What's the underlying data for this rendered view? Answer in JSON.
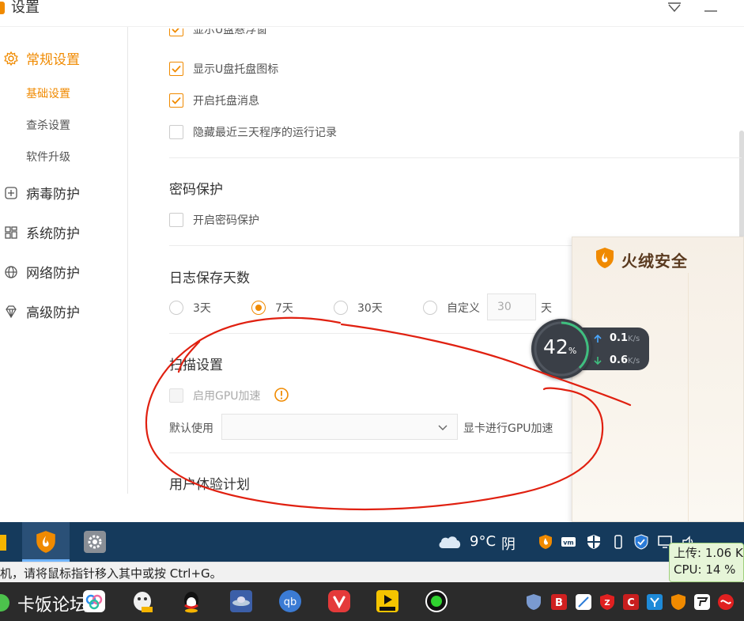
{
  "window": {
    "title": "设置"
  },
  "sidebar": {
    "groups": [
      {
        "label": "常规设置",
        "icon": "gear-icon"
      },
      {
        "label": "病毒防护",
        "icon": "plus-square-icon"
      },
      {
        "label": "系统防护",
        "icon": "grid-icon"
      },
      {
        "label": "网络防护",
        "icon": "globe-icon"
      },
      {
        "label": "高级防护",
        "icon": "diamond-icon"
      }
    ],
    "subitems": [
      "基础设置",
      "查杀设置",
      "软件升级"
    ]
  },
  "basic": {
    "cut_item": "显示U盘悬浮窗",
    "items": [
      {
        "label": "显示U盘托盘图标",
        "checked": true
      },
      {
        "label": "开启托盘消息",
        "checked": true
      },
      {
        "label": "隐藏最近三天程序的运行记录",
        "checked": false
      }
    ]
  },
  "password": {
    "title": "密码保护",
    "option": "开启密码保护"
  },
  "logs": {
    "title": "日志保存天数",
    "options": [
      "3天",
      "7天",
      "30天",
      "自定义"
    ],
    "selected": "7天",
    "custom_placeholder": "30",
    "unit": "天"
  },
  "scan": {
    "title": "扫描设置",
    "gpu_option": "启用GPU加速",
    "default_label": "默认使用",
    "suffix": "显卡进行GPU加速"
  },
  "ux": {
    "title": "用户体验计划"
  },
  "promo": {
    "brand": "火绒安全"
  },
  "speed": {
    "percent": "42",
    "percent_sign": "%",
    "up": "0.1",
    "down": "0.6",
    "unit": "K/s"
  },
  "taskbar": {
    "temp": "9°C",
    "condition": "阴"
  },
  "hint": "机，请将鼠标指针移入其中或按 Ctrl+G。",
  "netmon": {
    "up": "上传: 1.06 K",
    "cpu": "CPU: 14 %"
  },
  "taskbar2": {
    "forum": "卡饭论坛"
  },
  "colors": {
    "accent": "#f08a00",
    "taskbar": "#153a5c",
    "annotation": "#e02010"
  }
}
